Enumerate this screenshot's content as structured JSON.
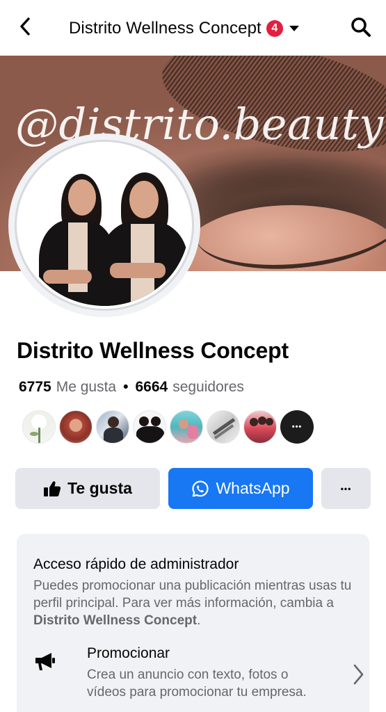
{
  "header": {
    "title": "Distrito Wellness Concept",
    "notification_count": "4",
    "badge_color": "#e41e3f"
  },
  "cover": {
    "overlay_text": "@distrito.beauty"
  },
  "profile": {
    "name": "Distrito Wellness Concept",
    "likes_count": "6775",
    "likes_label": "Me gusta",
    "separator": "•",
    "followers_count": "6664",
    "followers_label": "seguidores",
    "follower_avatars": [
      "white-rose-avatar",
      "woman-red-hair-avatar",
      "man-office-avatar",
      "two-women-avatar",
      "group-pool-avatar",
      "tools-avatar",
      "women-group-avatar"
    ],
    "more_followers_label": "•••"
  },
  "actions": {
    "like_label": "Te gusta",
    "whatsapp_label": "WhatsApp",
    "more_label": "•••",
    "primary_color": "#1877f2"
  },
  "admin_card": {
    "title": "Acceso rápido de administrador",
    "desc_prefix": "Puedes promocionar una publicación mientras usas tu perfil principal. Para ver más información, cambia a",
    "desc_page": "Distrito Wellness Concept",
    "desc_suffix": ".",
    "promote_title": "Promocionar",
    "promote_desc": "Crea un anuncio con texto, fotos o vídeos para promocionar tu empresa."
  }
}
